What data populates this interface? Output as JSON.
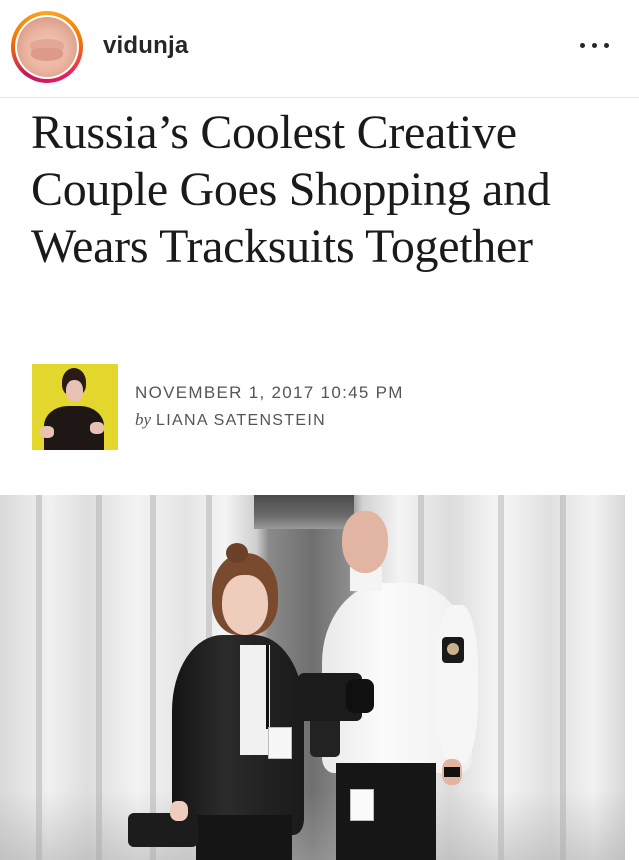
{
  "post": {
    "username": "vidunja",
    "more_icon": "ellipsis-icon"
  },
  "article": {
    "headline": "Russia’s Coolest Creative Couple Goes Shopping and Wears Tracksuits Together",
    "date": "NOVEMBER 1, 2017 10:45 PM",
    "byline_prefix": "by",
    "author": "LIANA SATENSTEIN"
  }
}
